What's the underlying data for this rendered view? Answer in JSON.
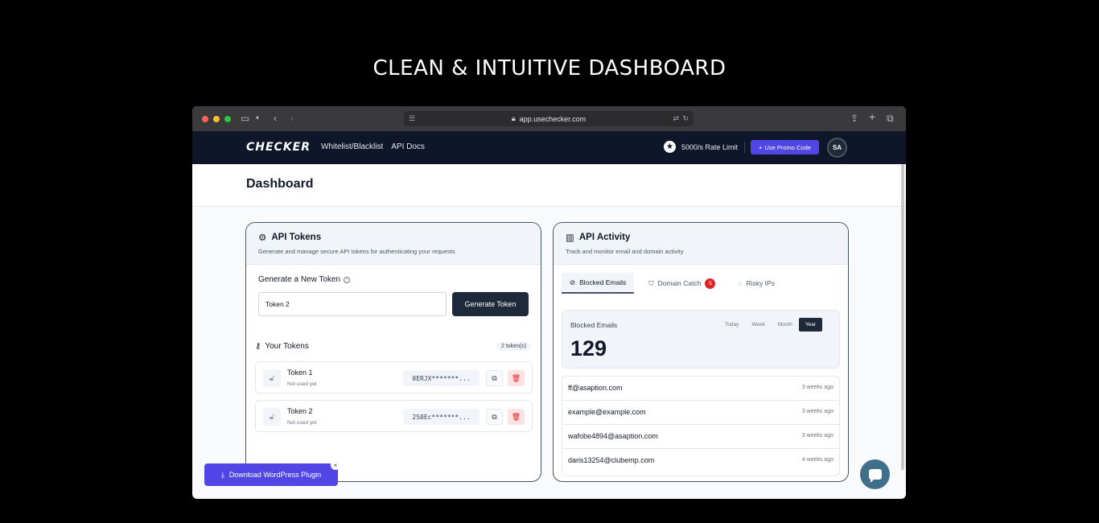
{
  "headline": "CLEAN & INTUITIVE DASHBOARD",
  "browser": {
    "url": "app.usechecker.com",
    "colors": {
      "close": "#ff5f57",
      "minimize": "#febc2e",
      "zoom": "#28c840"
    }
  },
  "nav": {
    "logo": "CHECKER",
    "links": [
      "Whitelist/Blacklist",
      "API Docs"
    ],
    "rate_limit": "5000/s Rate Limit",
    "promo_label": "Use Promo Code",
    "avatar_initials": "SA"
  },
  "page": {
    "title": "Dashboard"
  },
  "api_tokens": {
    "title": "API Tokens",
    "subtitle": "Generate and manage secure API tokens for authenticating your requests",
    "generate_label": "Generate a New Token",
    "input_value": "Token 2",
    "generate_button": "Generate Token",
    "your_tokens_label": "Your Tokens",
    "count": "2 token(s)",
    "tokens": [
      {
        "name": "Token 1",
        "status": "Not used yet",
        "key": "0ERJX*******..."
      },
      {
        "name": "Token 2",
        "status": "Not used yet",
        "key": "2S0Ec*******..."
      }
    ]
  },
  "api_activity": {
    "title": "API Activity",
    "subtitle": "Track and monitor email and domain activity",
    "tabs": [
      {
        "label": "Blocked Emails"
      },
      {
        "label": "Domain Catch",
        "badge": "5"
      },
      {
        "label": "Risky IPs"
      }
    ],
    "stats": {
      "label": "Blocked Emails",
      "value": "129"
    },
    "ranges": [
      "Today",
      "Week",
      "Month",
      "Year"
    ],
    "selected_range": "Year",
    "entries": [
      {
        "email": "ff@asaption.com",
        "time": "3 weeks ago"
      },
      {
        "email": "example@example.com",
        "time": "3 weeks ago"
      },
      {
        "email": "wafobe4894@asaption.com",
        "time": "3 weeks ago"
      },
      {
        "email": "daris13254@clubemp.com",
        "time": "4 weeks ago"
      }
    ]
  },
  "wordpress": {
    "label": "Download WordPress Plugin"
  },
  "colors": {
    "accent": "#5046e5",
    "navy": "#0f1629",
    "danger": "#dc2626"
  }
}
